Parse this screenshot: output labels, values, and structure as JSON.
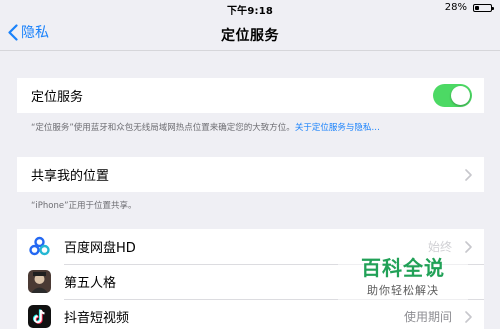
{
  "status_bar": {
    "time": "下午9:18",
    "battery_percent": "28%",
    "battery_level": 0.28
  },
  "nav": {
    "back_label": "隐私",
    "title": "定位服务"
  },
  "location_services": {
    "label": "定位服务",
    "toggle_on": true,
    "footnote_text": "“定位服务”使用蓝牙和众包无线局域网热点位置来确定您的大致方位。",
    "footnote_link": "关于定位服务与隐私…"
  },
  "share_location": {
    "label": "共享我的位置",
    "footnote": "“iPhone”正用于位置共享。"
  },
  "apps": [
    {
      "name": "百度网盘HD",
      "status": "始终",
      "icon": "baidu-netdisk-icon"
    },
    {
      "name": "第五人格",
      "status": "",
      "icon": "identity-v-icon"
    },
    {
      "name": "抖音短视频",
      "status": "使用期间",
      "icon": "douyin-icon"
    }
  ],
  "watermark": {
    "title": "百科全说",
    "subtitle": "助你轻松解决"
  },
  "colors": {
    "accent_blue": "#1a82fb",
    "toggle_green": "#4cd964",
    "background": "#efeff4",
    "watermark_green": "#21a157"
  }
}
